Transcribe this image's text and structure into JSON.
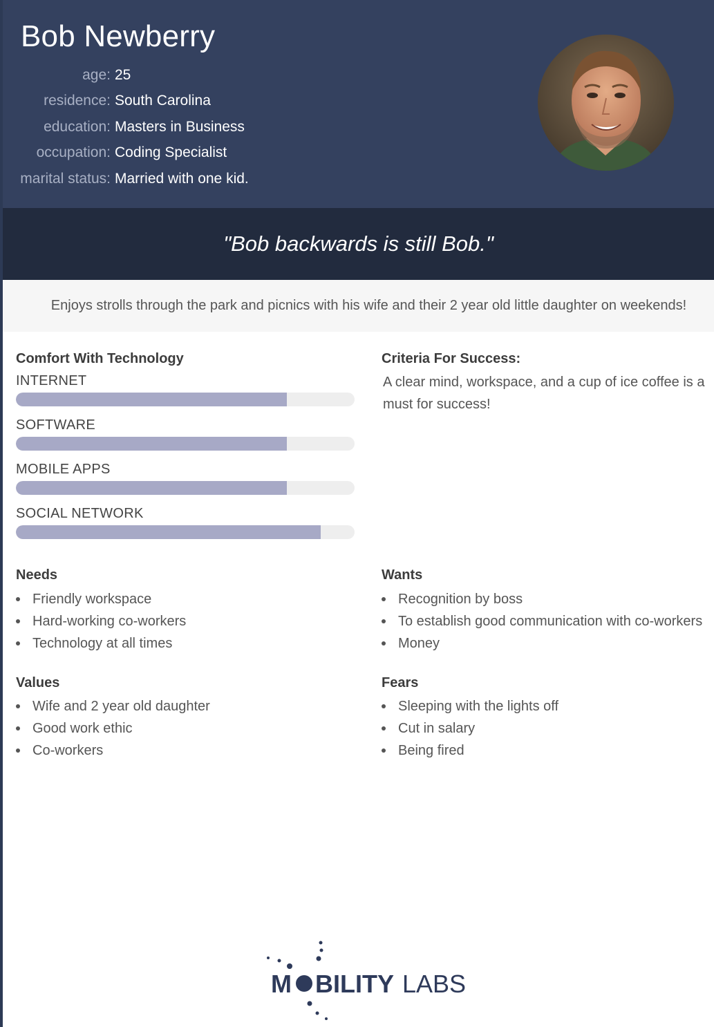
{
  "profile": {
    "name": "Bob Newberry",
    "details": [
      {
        "label": "age:",
        "value": "25"
      },
      {
        "label": "residence:",
        "value": "South Carolina"
      },
      {
        "label": "education:",
        "value": "Masters in Business"
      },
      {
        "label": "occupation:",
        "value": "Coding Specialist"
      },
      {
        "label": "marital status:",
        "value": "Married with one kid."
      }
    ],
    "avatar_icon": "person-photo"
  },
  "quote": "\"Bob backwards is still Bob.\"",
  "bio": "Enjoys strolls through the park and picnics with his wife and their 2 year old little daughter on weekends!",
  "comfort": {
    "title": "Comfort With Technology",
    "items": [
      {
        "label": "INTERNET",
        "level": 0.8
      },
      {
        "label": "SOFTWARE",
        "level": 0.8
      },
      {
        "label": "MOBILE APPS",
        "level": 0.8
      },
      {
        "label": "SOCIAL NETWORK",
        "level": 0.9
      }
    ]
  },
  "criteria": {
    "title": "Criteria For Success:",
    "text": "A clear mind, workspace, and a cup of ice coffee is a must for success!"
  },
  "needs": {
    "title": "Needs",
    "items": [
      "Friendly workspace",
      "Hard-working co-workers",
      "Technology at all times"
    ]
  },
  "wants": {
    "title": "Wants",
    "items": [
      "Recognition by boss",
      "To establish good communication with co-workers",
      "Money"
    ]
  },
  "values": {
    "title": "Values",
    "items": [
      "Wife and 2 year old daughter",
      "Good work ethic",
      "Co-workers"
    ]
  },
  "fears": {
    "title": "Fears",
    "items": [
      "Sleeping with the lights off",
      "Cut in salary",
      "Being fired"
    ]
  },
  "logo": {
    "text_o": "M",
    "text_rest": "BILITY",
    "text_labs": "LABS"
  },
  "colors": {
    "header": "#34415f",
    "quote_band": "#222b3e",
    "bar_fill": "#a7a9c6",
    "bar_track": "#eeeeee"
  }
}
